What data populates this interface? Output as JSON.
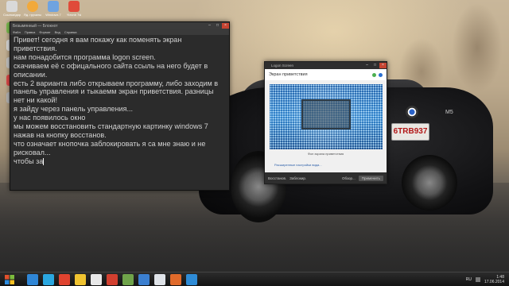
{
  "desktop": {
    "icons": [
      {
        "label": "Ссылки/дар",
        "color": "#d9d9d9"
      },
      {
        "label": "Яд. грузилы",
        "color": "#f2a93b"
      },
      {
        "label": "Windows 7",
        "color": "#6fa3e0"
      },
      {
        "label": "Ylecnb 7sl",
        "color": "#e04b3a"
      },
      {
        "label": "",
        "color": "#7fbf52"
      },
      {
        "label": "",
        "color": "#e0e0e0"
      },
      {
        "label": "",
        "color": "#c8c8c8"
      },
      {
        "label": "",
        "color": "#e14a4a"
      },
      {
        "label": "",
        "color": "#b8b8b8"
      }
    ]
  },
  "car": {
    "plate": "6TRB937",
    "badge": "M5"
  },
  "notepad": {
    "title": "Безымянный — Блокнот",
    "menu": [
      "Файл",
      "Правка",
      "Формат",
      "Вид",
      "Справка"
    ],
    "lines": [
      "Привет! сегодня я вам покажу как поменять экран приветствия.",
      "нам понадобится программа logon screen.",
      "скачиваем её с офицального сайта ссыль на него будет в описании.",
      "есть 2 варианта либо открываем программу, либо заходим в панель управления и тыкаемм экран приветствия. разницы нет ни какой!",
      "я зайду через панель управления...",
      "у нас появилось окно",
      "мы можем восстановить стандартную картинку windows 7 нажав на кнопку восстанов.",
      "что означает кнопочка заблокировать я са мне знаю и не рисковал...",
      "чтобы за"
    ]
  },
  "logon": {
    "title": "Logon Screen",
    "heading": "Экран приветствия",
    "caption": "Фон экрана приветствия",
    "advanced_link": "Расширенные настройки вида...",
    "buttons": {
      "restore": "Восстанов.",
      "lock": "Заблокир.",
      "browse": "Обзор...",
      "apply": "Применить"
    }
  },
  "taskbar": {
    "apps": [
      {
        "color": "#2f86d6"
      },
      {
        "color": "#2aa7e0"
      },
      {
        "color": "#e0432f"
      },
      {
        "color": "#f0c330"
      },
      {
        "color": "#e8e8e8"
      },
      {
        "color": "#d23f2f"
      },
      {
        "color": "#6fa34a"
      },
      {
        "color": "#3b7fd0"
      },
      {
        "color": "#dfe3e8"
      },
      {
        "color": "#e06a2a"
      },
      {
        "color": "#2e8bd6"
      }
    ],
    "language": "RU",
    "time": "1:48",
    "date": "17.06.2014"
  }
}
